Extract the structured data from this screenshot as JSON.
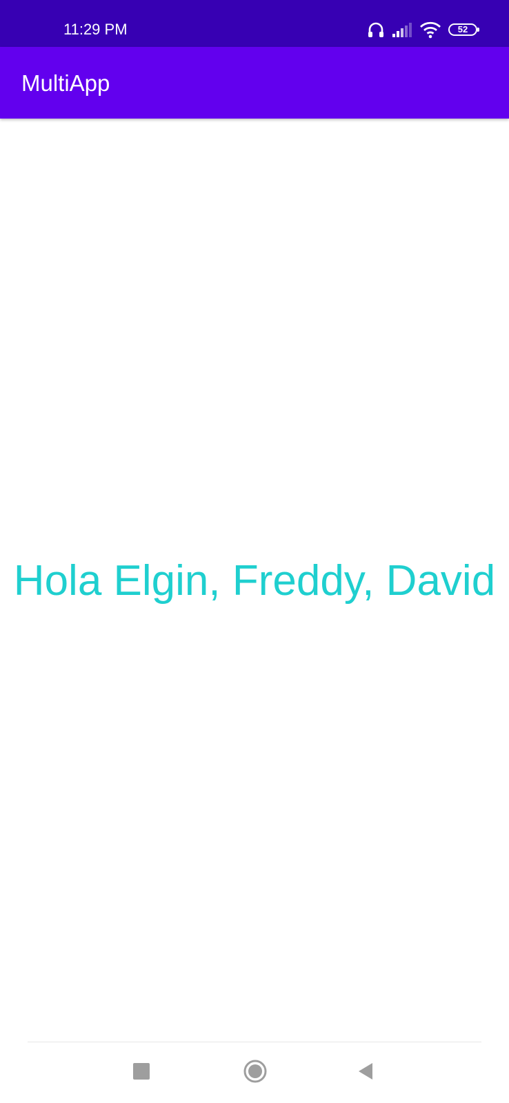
{
  "status_bar": {
    "time": "11:29 PM",
    "battery_level": "52",
    "icons": [
      "headset-icon",
      "signal-icon",
      "wifi-icon",
      "battery-icon"
    ]
  },
  "app_bar": {
    "title": "MultiApp"
  },
  "main": {
    "greeting": "Hola Elgin, Freddy, David"
  },
  "navigation_bar": {
    "buttons": [
      "recents-icon",
      "home-icon",
      "back-icon"
    ]
  },
  "colors": {
    "status_bar": "#3700B3",
    "app_bar": "#6200EE",
    "greeting_text": "#1FCFCF",
    "background": "#FFFFFF",
    "nav_icons": "#9E9E9E"
  }
}
